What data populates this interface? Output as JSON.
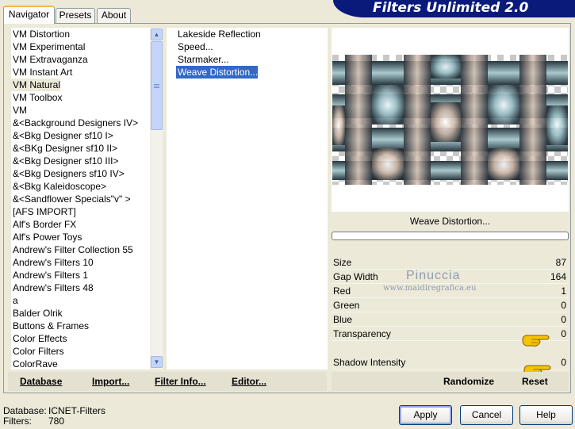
{
  "app": {
    "title": "Filters Unlimited 2.0"
  },
  "tabs": [
    {
      "label": "Navigator"
    },
    {
      "label": "Presets"
    },
    {
      "label": "About"
    }
  ],
  "categories": {
    "items": [
      "VM Distortion",
      "VM Experimental",
      "VM Extravaganza",
      "VM Instant Art",
      "VM Natural",
      "VM Toolbox",
      "VM",
      "&<Background Designers IV>",
      "&<Bkg Designer sf10 I>",
      "&<BKg Designer sf10 II>",
      "&<Bkg Designer sf10 III>",
      "&<Bkg Designers sf10 IV>",
      "&<Bkg Kaleidoscope>",
      "&<Sandflower Specials\"v\" >",
      "[AFS IMPORT]",
      "Alf's Border FX",
      "Alf's Power Toys",
      "Andrew's Filter Collection 55",
      "Andrew's Filters 10",
      "Andrew's Filters 1",
      "Andrew's Filters 48",
      "a",
      "Balder Olrik",
      "Buttons & Frames",
      "Color Effects",
      "Color Filters",
      "ColorRave"
    ],
    "selected": "VM Natural"
  },
  "filters": {
    "items": [
      "Lakeside Reflection",
      "Speed...",
      "Starmaker...",
      "Weave Distortion..."
    ],
    "selected": "Weave Distortion..."
  },
  "left_bar": {
    "database": "Database",
    "import": "Import...",
    "filter_info": "Filter Info...",
    "editor": "Editor..."
  },
  "preview": {
    "filter_name": "Weave Distortion..."
  },
  "params": [
    {
      "label": "Size",
      "value": "87"
    },
    {
      "label": "Gap Width",
      "value": "164"
    },
    {
      "label": "Red",
      "value": "1"
    },
    {
      "label": "Green",
      "value": "0"
    },
    {
      "label": "Blue",
      "value": "0"
    },
    {
      "label": "Transparency",
      "value": "0"
    },
    {
      "label": "Shadow Intensity",
      "value": "0"
    }
  ],
  "watermark": {
    "name": "Pinuccia",
    "site": "www.maidiregrafica.eu"
  },
  "right_bar": {
    "randomize": "Randomize",
    "reset": "Reset"
  },
  "footer": {
    "database_label": "Database:",
    "database_value": "ICNET-Filters",
    "filters_label": "Filters:",
    "filters_value": "780",
    "apply": "Apply",
    "cancel": "Cancel",
    "help": "Help"
  },
  "icons": {
    "scroll_up": "scroll-up-arrow-icon",
    "scroll_down": "scroll-down-arrow-icon",
    "pointer_hand": "pointing-hand-icon"
  },
  "colors": {
    "selection": "#316ac5",
    "banner": "#0a1a7a",
    "dialog": "#ece9d8"
  }
}
